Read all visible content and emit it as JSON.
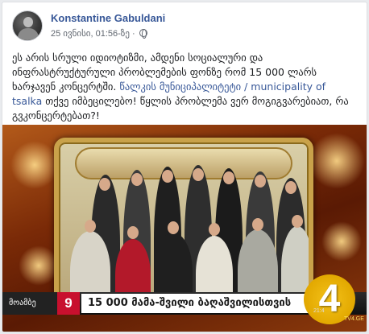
{
  "post": {
    "author": "Konstantine Gabuldani",
    "timestamp": "25 ივნისი, 01:56-ზე",
    "separator": " · ",
    "text_before_link": "ეს არის სრული იდიოტიზმი, ამდენი სოციალური და ინფრასტრუქტურული პრობლემების ფონზე რომ 15 000 ლარს ხარჯავენ კონცერტში. ",
    "link_text": "წალკის მუნიციპალიტეტი / municipality of tsalka",
    "text_after_link": " თქვე  იმბეცილებო! წყლის პრობლემა ვერ მოგიგვარებიათ, რა გვკონცერტებათ?!"
  },
  "video": {
    "ticker_label": "მოამბე",
    "ticker_number": "9",
    "ticker_headline": "15 000 მამა-შვილი ბაღაშვილისთვის",
    "channel_logo": "4",
    "channel_sub": "TV4.GE",
    "timecode": "21:4"
  },
  "icons": {
    "privacy": "globe-icon",
    "avatar": "avatar"
  },
  "colors": {
    "link": "#385898",
    "ticker_red": "#c8102e",
    "logo_yellow": "#f4c21a"
  }
}
